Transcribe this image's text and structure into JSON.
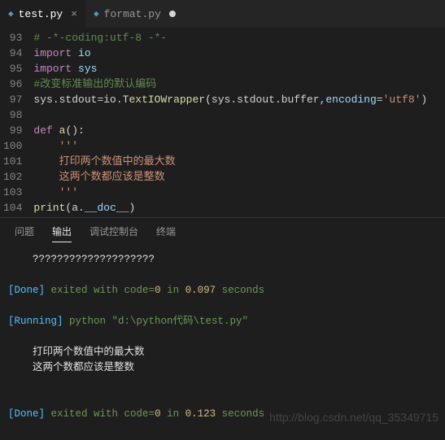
{
  "tabs": [
    {
      "label": "test.py",
      "active": true,
      "dirty": false
    },
    {
      "label": "format.py",
      "active": false,
      "dirty": true
    }
  ],
  "editor": {
    "lines": [
      {
        "num": "93",
        "tokens": [
          {
            "t": "# -*-coding:utf-8 -*-",
            "c": "c-comment"
          }
        ]
      },
      {
        "num": "94",
        "tokens": [
          {
            "t": "import",
            "c": "c-keyword"
          },
          {
            "t": " io",
            "c": "c-module"
          }
        ]
      },
      {
        "num": "95",
        "tokens": [
          {
            "t": "import",
            "c": "c-keyword"
          },
          {
            "t": " sys",
            "c": "c-module"
          }
        ]
      },
      {
        "num": "96",
        "tokens": [
          {
            "t": "#改变标准输出的默认编码",
            "c": "c-comment"
          }
        ]
      },
      {
        "num": "97",
        "tokens": [
          {
            "t": "sys",
            "c": "c-var"
          },
          {
            "t": ".",
            "c": "c-var"
          },
          {
            "t": "stdout",
            "c": "c-var"
          },
          {
            "t": "=",
            "c": "c-var"
          },
          {
            "t": "io",
            "c": "c-var"
          },
          {
            "t": ".",
            "c": "c-var"
          },
          {
            "t": "TextIOWrapper",
            "c": "c-func"
          },
          {
            "t": "(",
            "c": "c-var"
          },
          {
            "t": "sys",
            "c": "c-var"
          },
          {
            "t": ".",
            "c": "c-var"
          },
          {
            "t": "stdout",
            "c": "c-var"
          },
          {
            "t": ".",
            "c": "c-var"
          },
          {
            "t": "buffer",
            "c": "c-var"
          },
          {
            "t": ",",
            "c": "c-var"
          },
          {
            "t": "encoding",
            "c": "c-module"
          },
          {
            "t": "=",
            "c": "c-var"
          },
          {
            "t": "'utf8'",
            "c": "c-string"
          },
          {
            "t": ")",
            "c": "c-var"
          }
        ]
      },
      {
        "num": "98",
        "tokens": []
      },
      {
        "num": "99",
        "tokens": [
          {
            "t": "def",
            "c": "c-keyword"
          },
          {
            "t": " ",
            "c": "c-var"
          },
          {
            "t": "a",
            "c": "c-func"
          },
          {
            "t": "():",
            "c": "c-var"
          }
        ]
      },
      {
        "num": "100",
        "tokens": [
          {
            "t": "    '''",
            "c": "c-doc"
          }
        ]
      },
      {
        "num": "101",
        "tokens": [
          {
            "t": "    打印两个数值中的最大数",
            "c": "c-doc"
          }
        ]
      },
      {
        "num": "102",
        "tokens": [
          {
            "t": "    这两个数都应该是整数",
            "c": "c-doc"
          }
        ]
      },
      {
        "num": "103",
        "tokens": [
          {
            "t": "    '''",
            "c": "c-doc"
          }
        ]
      },
      {
        "num": "104",
        "tokens": [
          {
            "t": "print",
            "c": "c-func"
          },
          {
            "t": "(",
            "c": "c-var"
          },
          {
            "t": "a",
            "c": "c-var"
          },
          {
            "t": ".",
            "c": "c-var"
          },
          {
            "t": "__doc__",
            "c": "c-module"
          },
          {
            "t": ")",
            "c": "c-var"
          }
        ]
      }
    ]
  },
  "panel": {
    "tabs": [
      {
        "label": "问题",
        "active": false
      },
      {
        "label": "输出",
        "active": true
      },
      {
        "label": "调试控制台",
        "active": false
      },
      {
        "label": "终端",
        "active": false
      }
    ],
    "output_lines": [
      {
        "indent": "    ",
        "spans": [
          {
            "t": "????????????????????",
            "c": "o-white"
          }
        ]
      },
      {
        "indent": "",
        "spans": []
      },
      {
        "indent": "",
        "spans": [
          {
            "t": "[Done]",
            "c": "o-cyan"
          },
          {
            "t": " exited with ",
            "c": "o-green"
          },
          {
            "t": "code",
            "c": "o-green"
          },
          {
            "t": "=",
            "c": "o-green"
          },
          {
            "t": "0",
            "c": "o-yellow"
          },
          {
            "t": " in ",
            "c": "o-green"
          },
          {
            "t": "0.097",
            "c": "o-yellow"
          },
          {
            "t": " seconds",
            "c": "o-green"
          }
        ]
      },
      {
        "indent": "",
        "spans": []
      },
      {
        "indent": "",
        "spans": [
          {
            "t": "[Running]",
            "c": "o-cyan"
          },
          {
            "t": " python ",
            "c": "o-green"
          },
          {
            "t": "\"d:\\python代码\\test.py\"",
            "c": "o-green"
          }
        ]
      },
      {
        "indent": "",
        "spans": []
      },
      {
        "indent": "    ",
        "spans": [
          {
            "t": "打印两个数值中的最大数",
            "c": "o-white"
          }
        ]
      },
      {
        "indent": "    ",
        "spans": [
          {
            "t": "这两个数都应该是整数",
            "c": "o-white"
          }
        ]
      },
      {
        "indent": "    ",
        "spans": []
      },
      {
        "indent": "",
        "spans": []
      },
      {
        "indent": "",
        "spans": [
          {
            "t": "[Done]",
            "c": "o-cyan"
          },
          {
            "t": " exited with ",
            "c": "o-green"
          },
          {
            "t": "code",
            "c": "o-green"
          },
          {
            "t": "=",
            "c": "o-green"
          },
          {
            "t": "0",
            "c": "o-yellow"
          },
          {
            "t": " in ",
            "c": "o-green"
          },
          {
            "t": "0.123",
            "c": "o-yellow"
          },
          {
            "t": " seconds",
            "c": "o-green"
          }
        ]
      }
    ]
  },
  "watermark": "http://blog.csdn.net/qq_35349715",
  "icons": {
    "close": "×"
  }
}
